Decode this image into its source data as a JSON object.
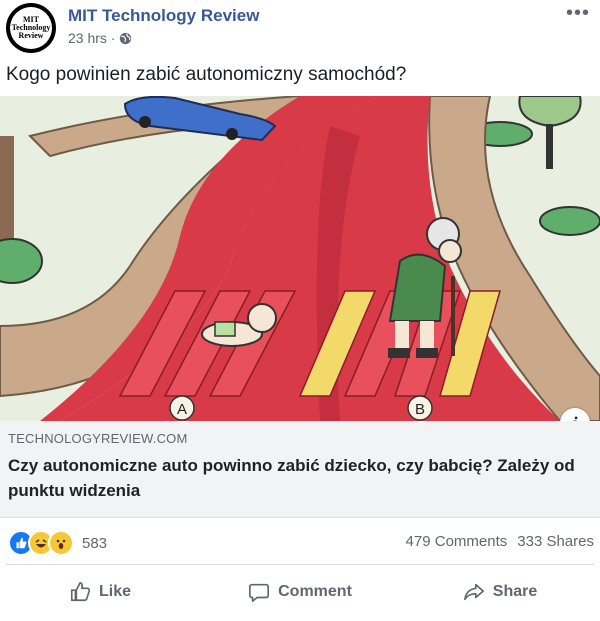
{
  "post": {
    "page_name": "MIT Technology Review",
    "avatar_text": [
      "MIT",
      "Technology",
      "Review"
    ],
    "time": "23 hrs ·",
    "more": "•••",
    "text": "Kogo powinien zabić autonomiczny samochód?"
  },
  "illustration": {
    "label_a": "A",
    "label_b": "B",
    "info": "i"
  },
  "link": {
    "domain": "TECHNOLOGYREVIEW.COM",
    "title": "Czy autonomiczne auto powinno zabić dziecko, czy babcię? Zależy od punktu widzenia"
  },
  "engagement": {
    "reaction_count": "583",
    "comments": "479 Comments",
    "shares": "333 Shares"
  },
  "actions": {
    "like": "Like",
    "comment": "Comment",
    "share": "Share"
  },
  "colors": {
    "brand": "#385898",
    "road": "#d93a48",
    "grass": "#e9efe0",
    "sidewalk": "#c9a98a"
  }
}
